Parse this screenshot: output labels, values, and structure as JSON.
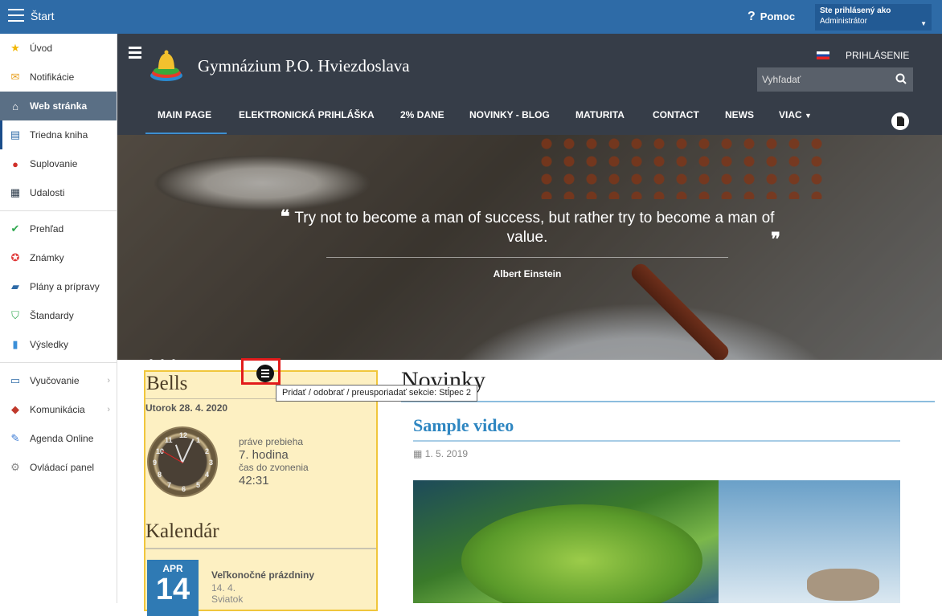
{
  "topbar": {
    "title": "Štart",
    "help": "Pomoc",
    "user_line1": "Ste prihlásený ako",
    "user_line2": "Administrátor"
  },
  "sidebar": {
    "items": [
      {
        "label": "Úvod",
        "icon": "star-icon"
      },
      {
        "label": "Notifikácie",
        "icon": "envelope-icon"
      },
      {
        "label": "Web stránka",
        "icon": "home-icon"
      },
      {
        "label": "Triedna kniha",
        "icon": "book-icon"
      },
      {
        "label": "Suplovanie",
        "icon": "person-icon"
      },
      {
        "label": "Udalosti",
        "icon": "calendar-icon"
      },
      {
        "label": "Prehľad",
        "icon": "check-circle-icon"
      },
      {
        "label": "Známky",
        "icon": "grades-icon"
      },
      {
        "label": "Plány a prípravy",
        "icon": "briefcase-icon"
      },
      {
        "label": "Štandardy",
        "icon": "shield-icon"
      },
      {
        "label": "Výsledky",
        "icon": "bar-chart-icon"
      },
      {
        "label": "Vyučovanie",
        "icon": "open-book-icon"
      },
      {
        "label": "Komunikácia",
        "icon": "chat-icon"
      },
      {
        "label": "Agenda Online",
        "icon": "pen-icon"
      },
      {
        "label": "Ovládací panel",
        "icon": "gear-icon"
      }
    ]
  },
  "site": {
    "title": "Gymnázium P.O. Hviezdoslava",
    "login": "PRIHLÁSENIE",
    "search_placeholder": "Vyhľadať"
  },
  "nav": {
    "tabs": [
      "MAIN PAGE",
      "ELEKTRONICKÁ PRIHLÁŠKA",
      "2% DANE",
      "NOVINKY - BLOG",
      "MATURITA",
      "CONTACT",
      "NEWS",
      "VIAC"
    ]
  },
  "hero": {
    "quote": "Try not to become a man of success, but rather try to become a man of value.",
    "author": "Albert Einstein"
  },
  "bells": {
    "title": "Bells",
    "date": "Utorok 28. 4. 2020",
    "now_label": "práve prebieha",
    "now_value": "7. hodina",
    "countdown_label": "čas do zvonenia",
    "countdown_value": "42:31"
  },
  "calendar": {
    "title": "Kalendár",
    "month": "APR",
    "day": "14",
    "event_title": "Veľkonočné prázdniny",
    "event_date": "14. 4.",
    "event_type": "Sviatok"
  },
  "tooltip": "Pridať / odobrať / preusporiadať sekcie: Stĺpec 2",
  "news": {
    "heading": "Novinky",
    "article_title": "Sample video",
    "article_date": "1. 5. 2019"
  },
  "colors": {
    "topbar": "#2e6ba7",
    "header": "#363d48",
    "accent": "#2e86c1",
    "bells_bg": "#fdf0c2",
    "highlight": "#e21b1b"
  }
}
